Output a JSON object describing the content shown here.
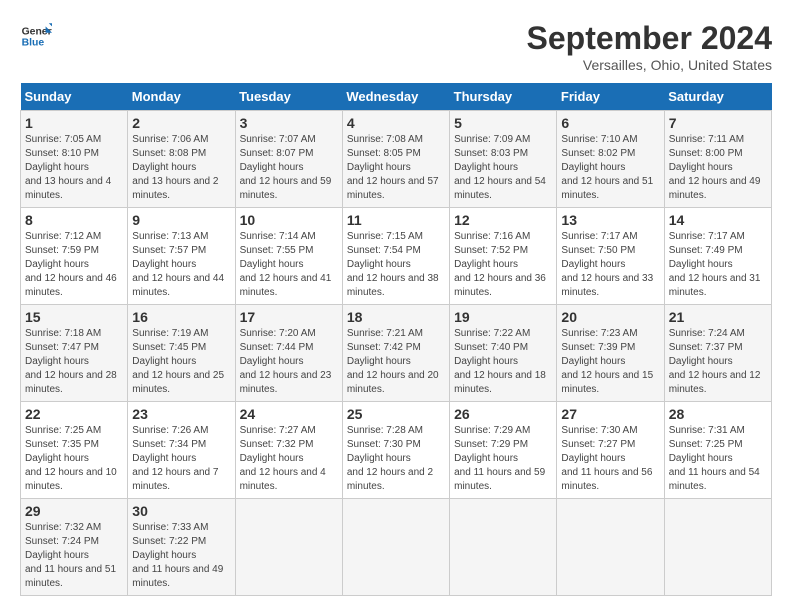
{
  "logo": {
    "line1": "General",
    "line2": "Blue"
  },
  "title": "September 2024",
  "location": "Versailles, Ohio, United States",
  "days_of_week": [
    "Sunday",
    "Monday",
    "Tuesday",
    "Wednesday",
    "Thursday",
    "Friday",
    "Saturday"
  ],
  "weeks": [
    [
      {
        "day": "1",
        "sunrise": "7:05 AM",
        "sunset": "8:10 PM",
        "daylight": "13 hours and 4 minutes."
      },
      {
        "day": "2",
        "sunrise": "7:06 AM",
        "sunset": "8:08 PM",
        "daylight": "13 hours and 2 minutes."
      },
      {
        "day": "3",
        "sunrise": "7:07 AM",
        "sunset": "8:07 PM",
        "daylight": "12 hours and 59 minutes."
      },
      {
        "day": "4",
        "sunrise": "7:08 AM",
        "sunset": "8:05 PM",
        "daylight": "12 hours and 57 minutes."
      },
      {
        "day": "5",
        "sunrise": "7:09 AM",
        "sunset": "8:03 PM",
        "daylight": "12 hours and 54 minutes."
      },
      {
        "day": "6",
        "sunrise": "7:10 AM",
        "sunset": "8:02 PM",
        "daylight": "12 hours and 51 minutes."
      },
      {
        "day": "7",
        "sunrise": "7:11 AM",
        "sunset": "8:00 PM",
        "daylight": "12 hours and 49 minutes."
      }
    ],
    [
      {
        "day": "8",
        "sunrise": "7:12 AM",
        "sunset": "7:59 PM",
        "daylight": "12 hours and 46 minutes."
      },
      {
        "day": "9",
        "sunrise": "7:13 AM",
        "sunset": "7:57 PM",
        "daylight": "12 hours and 44 minutes."
      },
      {
        "day": "10",
        "sunrise": "7:14 AM",
        "sunset": "7:55 PM",
        "daylight": "12 hours and 41 minutes."
      },
      {
        "day": "11",
        "sunrise": "7:15 AM",
        "sunset": "7:54 PM",
        "daylight": "12 hours and 38 minutes."
      },
      {
        "day": "12",
        "sunrise": "7:16 AM",
        "sunset": "7:52 PM",
        "daylight": "12 hours and 36 minutes."
      },
      {
        "day": "13",
        "sunrise": "7:17 AM",
        "sunset": "7:50 PM",
        "daylight": "12 hours and 33 minutes."
      },
      {
        "day": "14",
        "sunrise": "7:17 AM",
        "sunset": "7:49 PM",
        "daylight": "12 hours and 31 minutes."
      }
    ],
    [
      {
        "day": "15",
        "sunrise": "7:18 AM",
        "sunset": "7:47 PM",
        "daylight": "12 hours and 28 minutes."
      },
      {
        "day": "16",
        "sunrise": "7:19 AM",
        "sunset": "7:45 PM",
        "daylight": "12 hours and 25 minutes."
      },
      {
        "day": "17",
        "sunrise": "7:20 AM",
        "sunset": "7:44 PM",
        "daylight": "12 hours and 23 minutes."
      },
      {
        "day": "18",
        "sunrise": "7:21 AM",
        "sunset": "7:42 PM",
        "daylight": "12 hours and 20 minutes."
      },
      {
        "day": "19",
        "sunrise": "7:22 AM",
        "sunset": "7:40 PM",
        "daylight": "12 hours and 18 minutes."
      },
      {
        "day": "20",
        "sunrise": "7:23 AM",
        "sunset": "7:39 PM",
        "daylight": "12 hours and 15 minutes."
      },
      {
        "day": "21",
        "sunrise": "7:24 AM",
        "sunset": "7:37 PM",
        "daylight": "12 hours and 12 minutes."
      }
    ],
    [
      {
        "day": "22",
        "sunrise": "7:25 AM",
        "sunset": "7:35 PM",
        "daylight": "12 hours and 10 minutes."
      },
      {
        "day": "23",
        "sunrise": "7:26 AM",
        "sunset": "7:34 PM",
        "daylight": "12 hours and 7 minutes."
      },
      {
        "day": "24",
        "sunrise": "7:27 AM",
        "sunset": "7:32 PM",
        "daylight": "12 hours and 4 minutes."
      },
      {
        "day": "25",
        "sunrise": "7:28 AM",
        "sunset": "7:30 PM",
        "daylight": "12 hours and 2 minutes."
      },
      {
        "day": "26",
        "sunrise": "7:29 AM",
        "sunset": "7:29 PM",
        "daylight": "11 hours and 59 minutes."
      },
      {
        "day": "27",
        "sunrise": "7:30 AM",
        "sunset": "7:27 PM",
        "daylight": "11 hours and 56 minutes."
      },
      {
        "day": "28",
        "sunrise": "7:31 AM",
        "sunset": "7:25 PM",
        "daylight": "11 hours and 54 minutes."
      }
    ],
    [
      {
        "day": "29",
        "sunrise": "7:32 AM",
        "sunset": "7:24 PM",
        "daylight": "11 hours and 51 minutes."
      },
      {
        "day": "30",
        "sunrise": "7:33 AM",
        "sunset": "7:22 PM",
        "daylight": "11 hours and 49 minutes."
      },
      null,
      null,
      null,
      null,
      null
    ]
  ]
}
